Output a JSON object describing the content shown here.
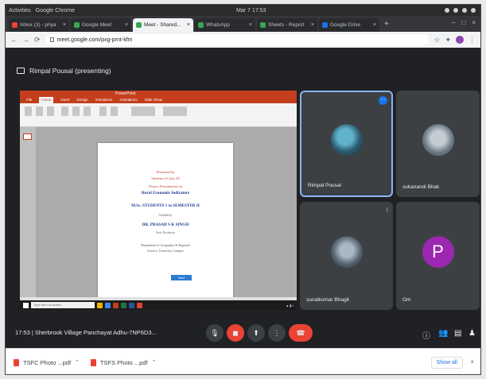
{
  "os": {
    "app": "Activities",
    "browser": "Google Chrome",
    "clock": "Mar 7 17:53"
  },
  "tabs": [
    {
      "label": "Inbox (3) - priya",
      "active": false
    },
    {
      "label": "Google Meet",
      "active": false
    },
    {
      "label": "Meet - Shared...",
      "active": true
    },
    {
      "label": "WhatsApp",
      "active": false
    },
    {
      "label": "Sheets - Report",
      "active": false
    },
    {
      "label": "Google Drive",
      "active": false
    }
  ],
  "address": {
    "url": "meet.google.com/pxg-prnt-kfm"
  },
  "meet": {
    "presenter_title": "Rimpal Pousal (presenting)",
    "meeting_info": "17:53 | Sherbrook Village Panchayat Adhu-7NP6D3...",
    "controls": [
      "mic",
      "camera",
      "present",
      "more",
      "end-call"
    ]
  },
  "slide": {
    "app_title": "PowerPoint",
    "ribbon_tabs": [
      "File",
      "Home",
      "Insert",
      "Design",
      "Transitions",
      "Animations",
      "Slide Show"
    ],
    "lines": [
      "Presented by",
      "Student of Class XI",
      "Project Presentation on",
      "Rural Economic Indicators",
      "M.Sc. STUDENTS 1 to SEMESTER II",
      "Guided by",
      "DR. PRASAD S K SINGH",
      "Asst. Professor",
      "Department of Geography & Regional",
      "Science, University Campus"
    ],
    "button": "Next",
    "taskbar_search": "Type here to search"
  },
  "participants": [
    {
      "name": "Rimpal Pousal",
      "initial": "",
      "speaking": true
    },
    {
      "name": "sukanandi Bhak",
      "initial": "",
      "speaking": false
    },
    {
      "name": "sunalkumar Bhagit",
      "initial": "",
      "speaking": false
    },
    {
      "name": "Om",
      "initial": "P",
      "speaking": false
    }
  ],
  "downloads": {
    "items": [
      "TSFC Photo ...pdf",
      "TSFS Photo ...pdf"
    ],
    "show_all": "Show all"
  }
}
